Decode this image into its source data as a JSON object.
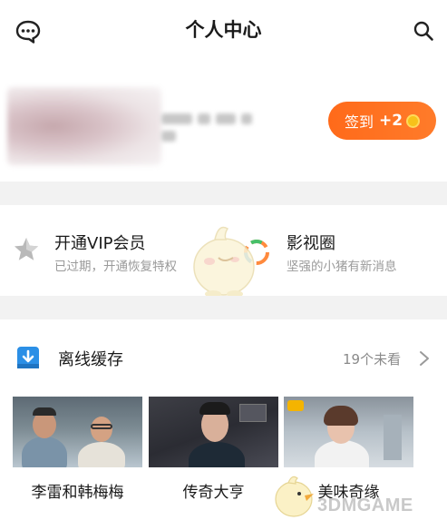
{
  "header": {
    "title": "个人中心",
    "left_icon": "message-icon",
    "right_icon": "search-icon"
  },
  "profile": {
    "signin_label": "签到",
    "signin_reward": "+2"
  },
  "features": {
    "vip": {
      "title": "开通VIP会员",
      "subtitle": "已过期，开通恢复特权",
      "icon": "star-icon"
    },
    "circle": {
      "title": "影视圈",
      "subtitle": "坚强的小猪有新消息",
      "icon": "circle-icon"
    }
  },
  "offline": {
    "title": "离线缓存",
    "unwatched": "19个未看",
    "icon": "download-icon",
    "items": [
      {
        "title": "李雷和韩梅梅"
      },
      {
        "title": "传奇大亨"
      },
      {
        "title": "美味奇缘"
      }
    ]
  },
  "watermark": {
    "text": "3DMGAME"
  },
  "colors": {
    "accent": "#ff6a1a",
    "download_blue": "#2b8fe6",
    "background_gap": "#f2f2f2"
  }
}
